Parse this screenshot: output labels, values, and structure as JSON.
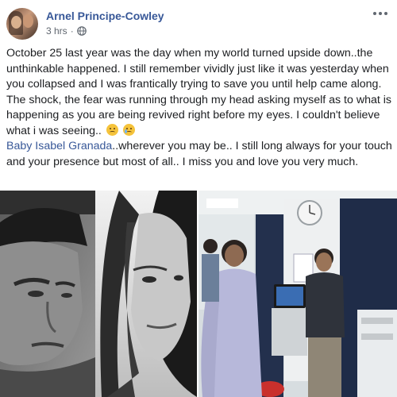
{
  "post": {
    "author": "Arnel Principe-Cowley",
    "time": "3 hrs",
    "privacy_icon": "globe-icon",
    "more_icon": "more-options-icon",
    "body_line1": "October 25 last year was the day when my world turned upside down..the unthinkable happened. I still remember vividly just like it was yesterday when you collapsed and I was frantically trying to save you until help came along. The shock, the fear was running through my head asking myself as to what is happening as you are being revived right before my eyes. I couldn't believe what i was seeing..",
    "body_emojis": [
      "disappointed-face-icon",
      "crying-face-icon"
    ],
    "tag_name": "Baby Isabel Granada",
    "body_line2": "..wherever you may be.. I still long always for your touch and your presence but most of all.. I miss you and love you very much."
  },
  "colors": {
    "author_link": "#385898",
    "text": "#1c1e21",
    "meta": "#606770"
  }
}
